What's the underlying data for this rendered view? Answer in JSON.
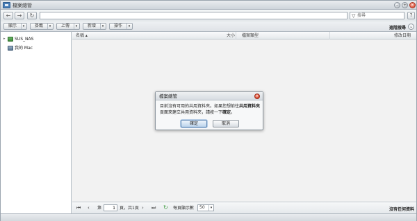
{
  "window": {
    "title": "檔案總管",
    "buttons": {
      "minimize": "–",
      "maximize": "+",
      "close": "×"
    }
  },
  "addressbar": {
    "back_icon": "arrow-left-icon",
    "forward_icon": "arrow-right-icon",
    "refresh_icon": "refresh-icon",
    "path_value": "",
    "search_placeholder": "搜尋",
    "help_label": "?"
  },
  "toolbar": {
    "buttons": [
      {
        "label": "顯示",
        "arrow": "▾"
      },
      {
        "label": "掛載",
        "arrow": "▾"
      },
      {
        "label": "上傳",
        "arrow": "▾"
      },
      {
        "label": "新增",
        "arrow": "▾"
      },
      {
        "label": "操作",
        "arrow": "▾"
      }
    ],
    "advanced_search": "進階搜尋",
    "collapse_symbol": "⌄"
  },
  "sidebar": {
    "items": [
      {
        "label": "SUS_NAS",
        "expander": "▸",
        "icon": "nas-icon"
      },
      {
        "label": "我的 Mac",
        "expander": "",
        "icon": "mac-icon"
      }
    ]
  },
  "list": {
    "columns": [
      {
        "label": "名稱 ▴"
      },
      {
        "label": "大小"
      },
      {
        "label": "檔案類型"
      },
      {
        "label": "修改日期"
      }
    ]
  },
  "pager": {
    "first_icon": "first-page-icon",
    "prev_icon": "prev-page-icon",
    "page_prefix": "第",
    "page_value": "1",
    "page_suffix": "頁，共1頁",
    "next_icon": "next-page-icon",
    "last_icon": "last-page-icon",
    "per_page_label": "每頁顯示數",
    "per_page_value": "50",
    "no_files": "沒有任何資料"
  },
  "dialog": {
    "title": "檔案總管",
    "message_part1": "目前沒有可用的共用資料夾。如果您想前往",
    "message_bold1": "共用資料夾",
    "message_part2": "頁面來建立共用資料夾，請按一下",
    "message_bold2": "確定",
    "message_part3": "。",
    "ok_label": "確定",
    "cancel_label": "取消",
    "close_symbol": "×"
  }
}
